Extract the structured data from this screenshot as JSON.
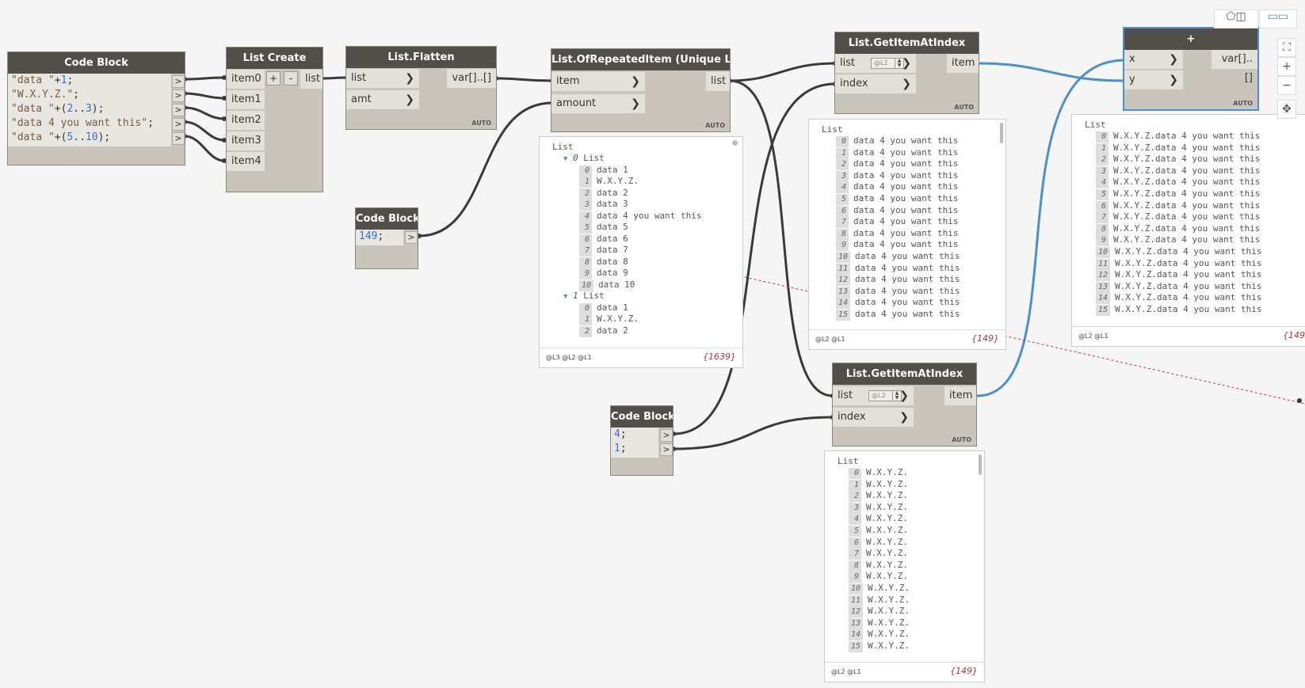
{
  "nodes": {
    "code_block_1": {
      "title": "Code Block",
      "lines": [
        [
          {
            "t": "\"data \"",
            "c": "str"
          },
          {
            "t": "+",
            "c": ""
          },
          {
            "t": "1",
            "c": "num"
          },
          {
            "t": ";",
            "c": ""
          }
        ],
        [
          {
            "t": "\"W.X.Y.Z.\"",
            "c": "str"
          },
          {
            "t": ";",
            "c": ""
          }
        ],
        [
          {
            "t": "\"data \"",
            "c": "str"
          },
          {
            "t": "+(",
            "c": ""
          },
          {
            "t": "2",
            "c": "num"
          },
          {
            "t": "..",
            "c": ""
          },
          {
            "t": "3",
            "c": "num"
          },
          {
            "t": ");",
            "c": ""
          }
        ],
        [
          {
            "t": "\"data 4 you want this\"",
            "c": "str"
          },
          {
            "t": ";",
            "c": ""
          }
        ],
        [
          {
            "t": "\"data \"",
            "c": "str"
          },
          {
            "t": "+(",
            "c": ""
          },
          {
            "t": "5",
            "c": "num"
          },
          {
            "t": "..",
            "c": ""
          },
          {
            "t": "10",
            "c": "num"
          },
          {
            "t": ");",
            "c": ""
          }
        ]
      ]
    },
    "list_create": {
      "title": "List Create",
      "inputs": [
        "item0",
        "item1",
        "item2",
        "item3",
        "item4"
      ],
      "output": "list",
      "add": "+",
      "remove": "-"
    },
    "list_flatten": {
      "title": "List.Flatten",
      "inputs": [
        "list",
        "amt"
      ],
      "output": "var[]..[]",
      "lacing": "AUTO"
    },
    "code_block_2": {
      "title": "Code Block",
      "value": "149",
      "suffix": ";"
    },
    "repeated": {
      "title": "List.OfRepeatedItem (Unique List)",
      "inputs": [
        "item",
        "amount"
      ],
      "output": "list",
      "lacing": "AUTO"
    },
    "get1": {
      "title": "List.GetItemAtIndex",
      "inputs": [
        "list",
        "index"
      ],
      "output": "item",
      "level": "@L2",
      "lacing": "AUTO"
    },
    "get2": {
      "title": "List.GetItemAtIndex",
      "inputs": [
        "list",
        "index"
      ],
      "output": "item",
      "level": "@L2",
      "lacing": "AUTO"
    },
    "code_block_3": {
      "title": "Code Block",
      "values": [
        "4",
        "1"
      ],
      "suffix": ";"
    },
    "add": {
      "title": "+",
      "inputs": [
        "x",
        "y"
      ],
      "output": "var[]..[]",
      "lacing": "AUTO"
    }
  },
  "previews": {
    "repeated": {
      "root": "List",
      "groups": [
        {
          "index": "0",
          "label": "List",
          "items": [
            "data 1",
            "W.X.Y.Z.",
            "data 2",
            "data 3",
            "data 4 you want this",
            "data 5",
            "data 6",
            "data 7",
            "data 8",
            "data 9",
            "data 10"
          ]
        },
        {
          "index": "1",
          "label": "List",
          "items": [
            "data 1",
            "W.X.Y.Z.",
            "data 2"
          ]
        }
      ],
      "levels": "@L3 @L2 @L1",
      "count": "{1639}"
    },
    "get1": {
      "root": "List",
      "items": [
        "data 4 you want this",
        "data 4 you want this",
        "data 4 you want this",
        "data 4 you want this",
        "data 4 you want this",
        "data 4 you want this",
        "data 4 you want this",
        "data 4 you want this",
        "data 4 you want this",
        "data 4 you want this",
        "data 4 you want this",
        "data 4 you want this",
        "data 4 you want this",
        "data 4 you want this",
        "data 4 you want this",
        "data 4 you want this"
      ],
      "levels": "@L2 @L1",
      "count": "{149}"
    },
    "get2": {
      "root": "List",
      "items": [
        "W.X.Y.Z.",
        "W.X.Y.Z.",
        "W.X.Y.Z.",
        "W.X.Y.Z.",
        "W.X.Y.Z.",
        "W.X.Y.Z.",
        "W.X.Y.Z.",
        "W.X.Y.Z.",
        "W.X.Y.Z.",
        "W.X.Y.Z.",
        "W.X.Y.Z.",
        "W.X.Y.Z.",
        "W.X.Y.Z.",
        "W.X.Y.Z.",
        "W.X.Y.Z.",
        "W.X.Y.Z."
      ],
      "levels": "@L2 @L1",
      "count": "{149}"
    },
    "add": {
      "root": "List",
      "items": [
        "W.X.Y.Z.data 4 you want this",
        "W.X.Y.Z.data 4 you want this",
        "W.X.Y.Z.data 4 you want this",
        "W.X.Y.Z.data 4 you want this",
        "W.X.Y.Z.data 4 you want this",
        "W.X.Y.Z.data 4 you want this",
        "W.X.Y.Z.data 4 you want this",
        "W.X.Y.Z.data 4 you want this",
        "W.X.Y.Z.data 4 you want this",
        "W.X.Y.Z.data 4 you want this",
        "W.X.Y.Z.data 4 you want this",
        "W.X.Y.Z.data 4 you want this",
        "W.X.Y.Z.data 4 you want this",
        "W.X.Y.Z.data 4 you want this",
        "W.X.Y.Z.data 4 you want this",
        "W.X.Y.Z.data 4 you want this"
      ],
      "levels": "@L2 @L1",
      "count": "{149"
    }
  },
  "toolbar": {
    "view_3d_icon": "geometry-view-icon",
    "view_graph_icon": "graph-view-icon",
    "zoom_fit": "⛶",
    "zoom_in": "+",
    "zoom_out": "−",
    "pan": "✥"
  },
  "colors": {
    "wire": "#3a3a3a",
    "selected_wire": "#4a8fd0",
    "node_header": "#524e4a",
    "node_body": "#c9c5bd"
  }
}
